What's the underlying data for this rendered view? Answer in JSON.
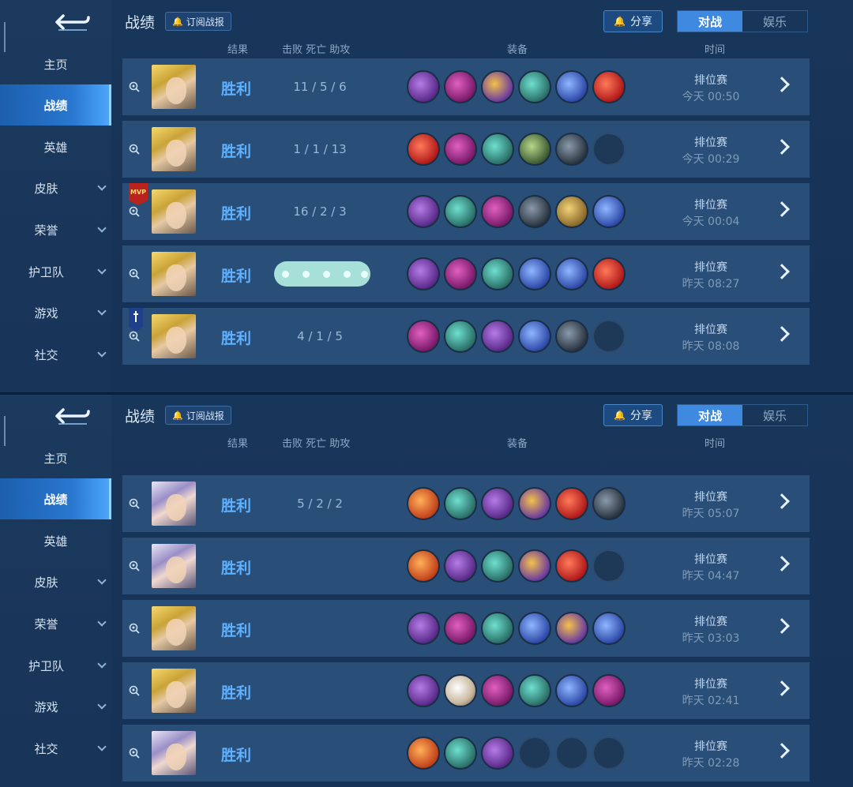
{
  "header": {
    "title": "战绩",
    "subscribe_label": "订阅战报",
    "share_label": "分享",
    "tabs": [
      {
        "label": "对战",
        "active": true
      },
      {
        "label": "娱乐",
        "active": false
      }
    ]
  },
  "columns": {
    "result": "结果",
    "kda": "击败 死亡 助攻",
    "items": "装备",
    "time": "时间"
  },
  "sidebar": {
    "items": [
      {
        "label": "主页",
        "active": false,
        "expandable": false
      },
      {
        "label": "战绩",
        "active": true,
        "expandable": false
      },
      {
        "label": "英雄",
        "active": false,
        "expandable": false
      },
      {
        "label": "皮肤",
        "active": false,
        "expandable": true
      },
      {
        "label": "荣誉",
        "active": false,
        "expandable": true
      },
      {
        "label": "护卫队",
        "active": false,
        "expandable": true
      },
      {
        "label": "游戏",
        "active": false,
        "expandable": true
      },
      {
        "label": "社交",
        "active": false,
        "expandable": true
      }
    ]
  },
  "panel_top_matches": [
    {
      "result": "胜利",
      "kda": "11 / 5 / 6",
      "mode": "排位赛",
      "time": "今天 00:50",
      "hero": "blond",
      "badge": "",
      "items": [
        "c-purple",
        "c-magenta",
        "c-gold",
        "c-teal",
        "c-blue",
        "c-red"
      ]
    },
    {
      "result": "胜利",
      "kda": "1 / 1 / 13",
      "mode": "排位赛",
      "time": "今天 00:29",
      "hero": "blond",
      "badge": "",
      "items": [
        "c-red",
        "c-magenta",
        "c-teal",
        "c-green",
        "c-dark",
        "empty"
      ]
    },
    {
      "result": "胜利",
      "kda": "16 / 2 / 3",
      "mode": "排位赛",
      "time": "今天 00:04",
      "hero": "blond",
      "badge": "MVP",
      "items": [
        "c-purple",
        "c-teal",
        "c-magenta",
        "c-dark",
        "c-yellow",
        "c-blue"
      ]
    },
    {
      "result": "胜利",
      "kda": "",
      "mode": "排位赛",
      "time": "昨天 08:27",
      "hero": "blond",
      "badge": "",
      "obscured": true,
      "items": [
        "c-purple",
        "c-magenta",
        "c-teal",
        "c-blue",
        "c-blue",
        "c-red"
      ]
    },
    {
      "result": "胜利",
      "kda": "4 / 1 / 5",
      "mode": "排位赛",
      "time": "昨天 08:08",
      "hero": "blond",
      "badge": "banner",
      "items": [
        "c-magenta",
        "c-teal",
        "c-purple",
        "c-blue",
        "c-dark",
        "empty"
      ]
    }
  ],
  "panel_bottom_matches": [
    {
      "result": "胜利",
      "kda": "5 / 2 / 2",
      "mode": "排位赛",
      "time": "昨天 05:07",
      "hero": "silver",
      "badge": "",
      "items": [
        "c-orange",
        "c-teal",
        "c-purple",
        "c-gold",
        "c-red",
        "c-dark"
      ]
    },
    {
      "result": "胜利",
      "kda": "",
      "mode": "排位赛",
      "time": "昨天 04:47",
      "hero": "silver",
      "badge": "",
      "items": [
        "c-orange",
        "c-purple",
        "c-teal",
        "c-gold",
        "c-red",
        "empty"
      ]
    },
    {
      "result": "胜利",
      "kda": "",
      "mode": "排位赛",
      "time": "昨天 03:03",
      "hero": "blond",
      "badge": "",
      "items": [
        "c-purple",
        "c-magenta",
        "c-teal",
        "c-blue",
        "c-gold",
        "c-blue"
      ]
    },
    {
      "result": "胜利",
      "kda": "",
      "mode": "排位赛",
      "time": "昨天 02:41",
      "hero": "blond",
      "badge": "",
      "items": [
        "c-purple",
        "c-cream",
        "c-magenta",
        "c-teal",
        "c-blue",
        "c-magenta"
      ]
    },
    {
      "result": "胜利",
      "kda": "",
      "mode": "排位赛",
      "time": "昨天 02:28",
      "hero": "silver",
      "badge": "",
      "items": [
        "c-orange",
        "c-teal",
        "c-purple",
        "empty",
        "empty",
        "empty"
      ]
    }
  ]
}
